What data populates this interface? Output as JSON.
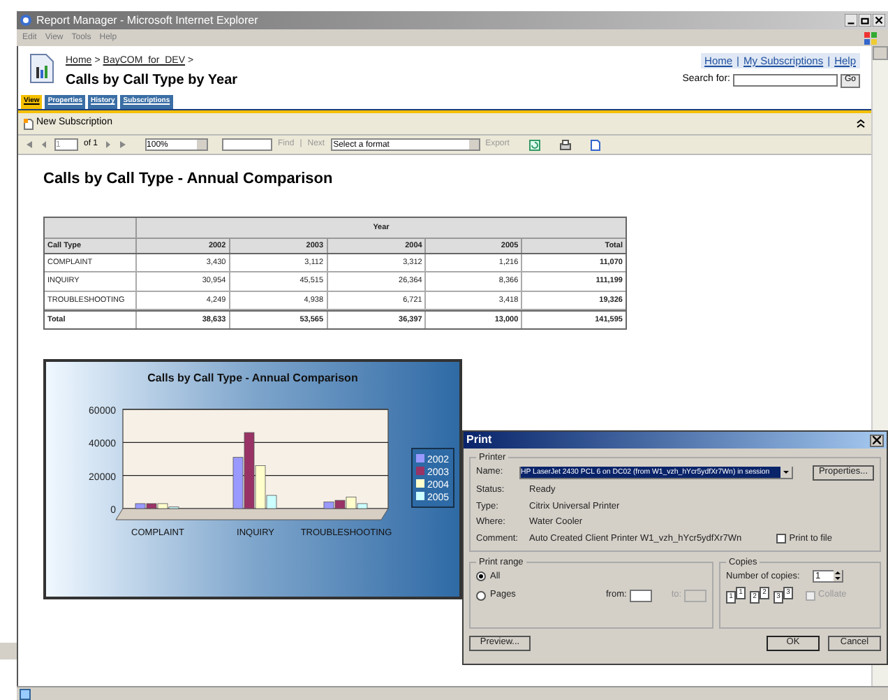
{
  "window": {
    "title": "Report Manager - Microsoft Internet Explorer"
  },
  "menu": [
    "Edit",
    "View",
    "Tools",
    "Help"
  ],
  "header": {
    "breadcrumb": {
      "items": [
        "Home",
        "BayCOM_for_DEV"
      ],
      "separator": ">"
    },
    "title": "Calls by Call Type by Year",
    "top_links": {
      "items": [
        "Home",
        "My Subscriptions",
        "Help"
      ],
      "separator": "|"
    },
    "search": {
      "label": "Search for:",
      "button": "Go"
    }
  },
  "tabs": [
    {
      "label": "View",
      "selected": true
    },
    {
      "label": "Properties",
      "selected": false
    },
    {
      "label": "History",
      "selected": false
    },
    {
      "label": "Subscriptions",
      "selected": false
    }
  ],
  "action_bar": {
    "label": "New Subscription"
  },
  "toolbar": {
    "page": "1",
    "of": "of 1",
    "zoom": "100%",
    "find": "Find",
    "separator": "|",
    "next": "Next",
    "format": "Select a format",
    "export": "Export"
  },
  "report": {
    "title": "Calls by Call Type - Annual Comparison",
    "table": {
      "group_header": "Year",
      "columns": [
        "Call Type",
        "2002",
        "2003",
        "2004",
        "2005",
        "Total"
      ],
      "rows": [
        [
          "COMPLAINT",
          "3,430",
          "3,112",
          "3,312",
          "1,216",
          "11,070"
        ],
        [
          "INQUIRY",
          "30,954",
          "45,515",
          "26,364",
          "8,366",
          "111,199"
        ],
        [
          "TROUBLESHOOTING",
          "4,249",
          "4,938",
          "6,721",
          "3,418",
          "19,326"
        ]
      ],
      "total": [
        "Total",
        "38,633",
        "53,565",
        "36,397",
        "13,000",
        "141,595"
      ]
    },
    "chart_data": {
      "type": "bar",
      "title": "Calls by Call Type - Annual Comparison",
      "legend": true,
      "categories": [
        "COMPLAINT",
        "INQUIRY",
        "TROUBLESHOOTING"
      ],
      "ylim": [
        0,
        60000
      ],
      "yticks": [
        0,
        20000,
        40000,
        60000
      ],
      "series": [
        {
          "name": "2002",
          "color": "#9999ff",
          "values": [
            3000,
            31000,
            4000
          ]
        },
        {
          "name": "2003",
          "color": "#993366",
          "values": [
            3000,
            46000,
            5000
          ]
        },
        {
          "name": "2004",
          "color": "#ffffcc",
          "values": [
            3000,
            26000,
            7000
          ]
        },
        {
          "name": "2005",
          "color": "#ccffff",
          "values": [
            1000,
            8000,
            3000
          ]
        }
      ]
    }
  },
  "print_dialog": {
    "title": "Print",
    "printer": {
      "label": "Printer",
      "name_label": "Name:",
      "name": "HP LaserJet 2430 PCL 6 on DC02 (from W1_vzh_hYcr5ydfXr7Wn) in session",
      "properties": "Properties...",
      "details": [
        {
          "label": "Status:",
          "value": "Ready"
        },
        {
          "label": "Type:",
          "value": "Citrix Universal Printer"
        },
        {
          "label": "Where:",
          "value": "Water Cooler"
        },
        {
          "label": "Comment:",
          "value": "Auto Created Client Printer W1_vzh_hYcr5ydfXr7Wn"
        }
      ],
      "print_to_file": {
        "label": "Print to file",
        "checked": false
      }
    },
    "print_range": {
      "label": "Print range",
      "options": [
        {
          "label": "All",
          "selected": true
        },
        {
          "label": "Pages",
          "selected": false
        }
      ],
      "from": {
        "label": "from:",
        "disabled": false
      },
      "to": {
        "label": "to:",
        "disabled": true
      }
    },
    "copies": {
      "label": "Copies",
      "number_label": "Number of copies:",
      "number": "1",
      "pages": [
        "1",
        "1",
        "2",
        "2",
        "3",
        "3"
      ],
      "collate": {
        "label": "Collate",
        "checked": false,
        "disabled": true
      }
    },
    "buttons": {
      "preview": "Preview...",
      "ok": "OK",
      "cancel": "Cancel"
    }
  }
}
